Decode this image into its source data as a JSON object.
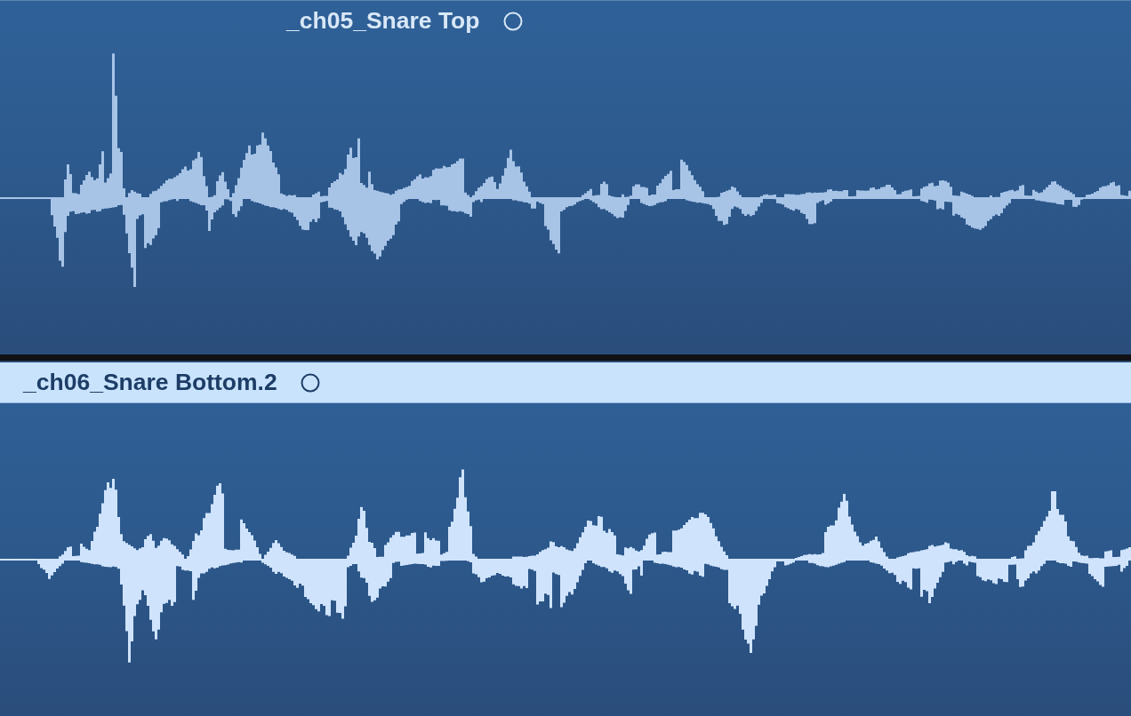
{
  "regions": [
    {
      "name": "_ch05_Snare Top",
      "selected": false
    },
    {
      "name": "_ch06_Snare Bottom.2",
      "selected": true
    }
  ]
}
